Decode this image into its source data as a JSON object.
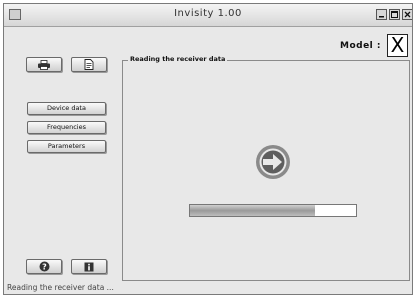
{
  "window": {
    "title": "Invisity 1.00"
  },
  "model": {
    "label": "Model :",
    "value": "X"
  },
  "sidebar": {
    "buttons": [
      {
        "label": "Device data"
      },
      {
        "label": "Frequencies"
      },
      {
        "label": "Parameters"
      }
    ]
  },
  "panel": {
    "group_label": "Reading the receiver data",
    "progress": 0.75
  },
  "statusbar": {
    "text": "Reading the receiver data ..."
  },
  "icons": {
    "print": "printer-icon",
    "document": "document-icon",
    "help": "help-icon",
    "info": "info-icon",
    "transfer": "transfer-arrow-icon"
  }
}
